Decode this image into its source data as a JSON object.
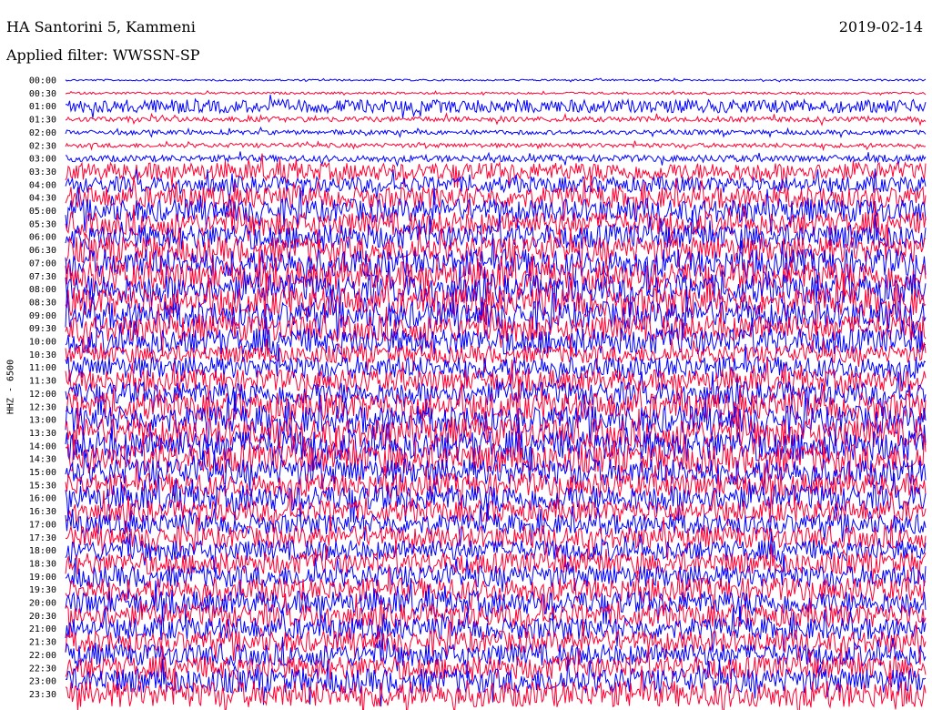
{
  "header": {
    "station": "HA Santorini 5, Kammeni",
    "date": "2019-02-14",
    "filter": "Applied filter: WWSSN-SP",
    "channel": "HHZ - 6500"
  },
  "chart_data": {
    "type": "line",
    "title": "HA Santorini 5, Kammeni",
    "ylabel": "HHZ - 6500",
    "colors": [
      "#0000ff",
      "#ff0033"
    ],
    "rows": [
      "00:00",
      "00:30",
      "01:00",
      "01:30",
      "02:00",
      "02:30",
      "03:00",
      "03:30",
      "04:00",
      "04:30",
      "05:00",
      "05:30",
      "06:00",
      "06:30",
      "07:00",
      "07:30",
      "08:00",
      "08:30",
      "09:00",
      "09:30",
      "10:00",
      "10:30",
      "11:00",
      "11:30",
      "12:00",
      "12:30",
      "13:00",
      "13:30",
      "14:00",
      "14:30",
      "15:00",
      "15:30",
      "16:00",
      "16:30",
      "17:00",
      "17:30",
      "18:00",
      "18:30",
      "19:00",
      "19:30",
      "20:00",
      "20:30",
      "21:00",
      "21:30",
      "22:00",
      "22:30",
      "23:00",
      "23:30"
    ],
    "amplitude": [
      0.12,
      0.15,
      0.9,
      0.35,
      0.3,
      0.3,
      0.45,
      1.2,
      1.1,
      1.5,
      1.6,
      1.6,
      1.7,
      1.8,
      1.9,
      2.0,
      2.0,
      2.0,
      1.9,
      1.8,
      1.8,
      1.2,
      1.5,
      1.5,
      1.6,
      1.9,
      1.9,
      2.0,
      2.1,
      2.0,
      1.8,
      1.6,
      1.8,
      1.5,
      1.4,
      1.5,
      1.4,
      1.5,
      1.5,
      1.6,
      1.6,
      1.6,
      1.5,
      1.5,
      1.5,
      1.6,
      1.7,
      1.8
    ]
  }
}
